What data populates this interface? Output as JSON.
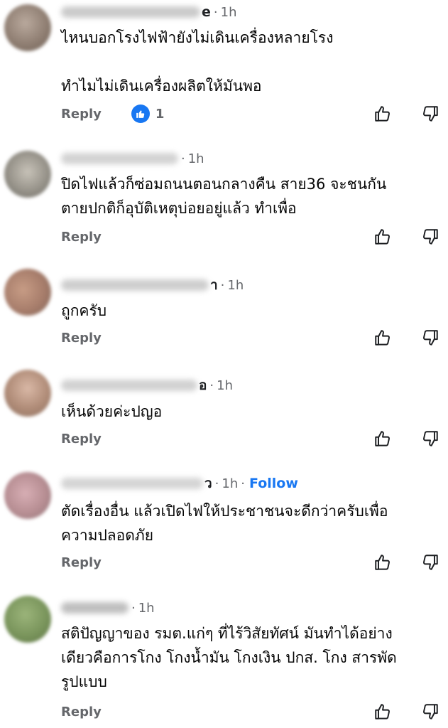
{
  "ui": {
    "reply_label": "Reply",
    "follow_label": "Follow",
    "colors": {
      "secondary_text": "#65676b",
      "link_blue": "#1877f2",
      "body_text": "#050505"
    }
  },
  "comments": [
    {
      "name_visible_tail": "e",
      "time": "1h",
      "text": "ไหนบอกโรงไฟฟ้ายังไม่เดินเครื่องหลายโรง\n\nทำไมไม่เดินเครื่องผลิตให้มันพอ",
      "reactions": "1",
      "reaction_icon": "like-icon"
    },
    {
      "name_visible_tail": "",
      "time": "1h",
      "text": "ปิดไฟแล้วก็ซ่อมถนนตอนกลางคืน สาย36 จะชนกัน\nตายปกติก็อุบัติเหตุบ่อยอยู่แล้ว ทำเพื่อ"
    },
    {
      "name_visible_tail": "า",
      "time": "1h",
      "text": "ถูกครับ"
    },
    {
      "name_visible_tail": "อ",
      "time": "1h",
      "text": "เห็นด้วยค่ะปญอ"
    },
    {
      "name_visible_tail": "ว",
      "time": "1h",
      "text": "ตัดเรื่องอื่น แล้วเปิดไฟให้ประชาชนจะดีกว่าครับเพื่อ\nความปลอดภัย"
    },
    {
      "name_visible_tail": "",
      "time": "1h",
      "text": "สติปัญญาของ รมต.แก่ๆ ที่ไร้วิสัยทัศน์ มันทำได้อย่าง\nเดียวคือการโกง โกงน้ำมัน โกงเงิน ปกส. โกง สารพัด\nรูปแบบ"
    }
  ]
}
